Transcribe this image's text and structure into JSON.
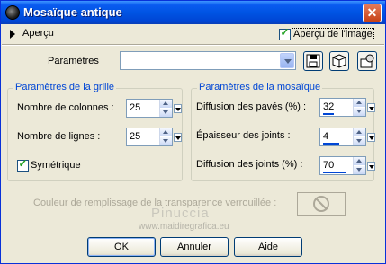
{
  "window": {
    "title": "Mosaïque antique"
  },
  "preview": {
    "section_label": "Aperçu",
    "show_preview_label": "Aperçu de l'image",
    "show_preview_checked": true
  },
  "presets": {
    "label": "Paramètres",
    "value": ""
  },
  "grid": {
    "title": "Paramètres de la grille",
    "columns_label": "Nombre de colonnes :",
    "columns_value": "25",
    "rows_label": "Nombre de lignes :",
    "rows_value": "25",
    "symmetric_label": "Symétrique",
    "symmetric_checked": true
  },
  "mosaic": {
    "title": "Paramètres de la mosaïque",
    "tile_diffusion_label": "Diffusion des pavés (%) :",
    "tile_diffusion_value": "32",
    "joint_thickness_label": "Épaisseur des joints :",
    "joint_thickness_value": "4",
    "joint_diffusion_label": "Diffusion des joints (%) :",
    "joint_diffusion_value": "70"
  },
  "fill": {
    "label": "Couleur de remplissage de la transparence verrouillée :"
  },
  "watermark": {
    "name": "Pinuccia",
    "url": "www.maidiregrafica.eu"
  },
  "buttons": {
    "ok": "OK",
    "cancel": "Annuler",
    "help": "Aide"
  }
}
